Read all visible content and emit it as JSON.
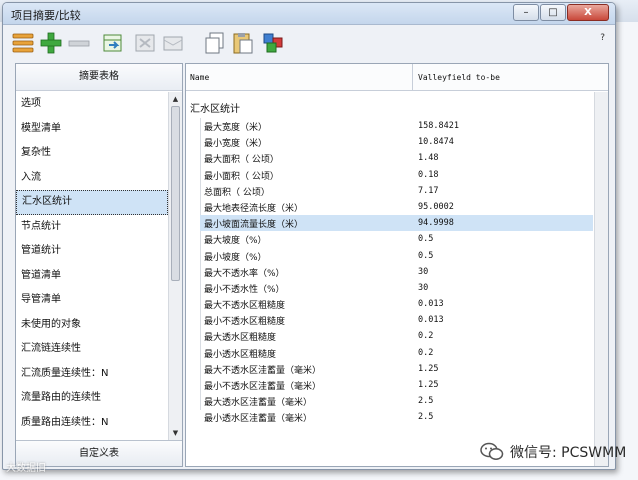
{
  "window": {
    "title": "项目摘要/比较",
    "minimize": "–",
    "maximize": "□",
    "close": "X",
    "version": "?"
  },
  "toolbar": {
    "buttons": [
      "list-icon",
      "add-icon",
      "remove-icon",
      "export-icon",
      "table-icon",
      "card-icon",
      "copy-icon",
      "paste-icon",
      "cubes-icon"
    ]
  },
  "left": {
    "header": "摘要表格",
    "items": [
      "选项",
      "模型清单",
      "复杂性",
      "入流",
      "汇水区统计",
      "节点统计",
      "管道统计",
      "管道清单",
      "导管清单",
      "未使用的对象",
      "汇流链连续性",
      "汇流质量连续性：N",
      "流量路由的连续性",
      "质量路由连续性：N"
    ],
    "selected_index": 4,
    "footer": "自定义表"
  },
  "grid": {
    "col_name": "Name",
    "col_value": "Valleyfield to-be",
    "group": "汇水区统计",
    "selected_index": 6,
    "rows": [
      {
        "name": "最大宽度（米）",
        "value": "158.8421"
      },
      {
        "name": "最小宽度（米）",
        "value": "10.8474"
      },
      {
        "name": "最大面积（ 公顷）",
        "value": "1.48"
      },
      {
        "name": "最小面积（ 公顷）",
        "value": "0.18"
      },
      {
        "name": "总面积（ 公顷）",
        "value": "7.17"
      },
      {
        "name": "最大地表径流长度（米）",
        "value": "95.0002"
      },
      {
        "name": "最小坡面流量长度（米）",
        "value": "94.9998"
      },
      {
        "name": "最大坡度（%）",
        "value": "0.5"
      },
      {
        "name": "最小坡度（%）",
        "value": "0.5"
      },
      {
        "name": "最大不透水率（%）",
        "value": "30"
      },
      {
        "name": "最小不透水性（%）",
        "value": "30"
      },
      {
        "name": "最大不透水区粗糙度",
        "value": "0.013"
      },
      {
        "name": "最小不透水区粗糙度",
        "value": "0.013"
      },
      {
        "name": "最大透水区粗糙度",
        "value": "0.2"
      },
      {
        "name": "最小透水区粗糙度",
        "value": "0.2"
      },
      {
        "name": "最大不透水区洼蓄量（毫米）",
        "value": "1.25"
      },
      {
        "name": "最小不透水区洼蓄量（毫米）",
        "value": "1.25"
      },
      {
        "name": "最大透水区洼蓄量（毫米）",
        "value": "2.5"
      },
      {
        "name": "最小透水区洼蓄量（毫米）",
        "value": "2.5"
      }
    ]
  },
  "watermark": {
    "right": "微信号: PCSWMM",
    "left": "大数据旧"
  },
  "colors": {
    "selection": "#cfe3f6",
    "titlebar": "#c4d6ec"
  }
}
